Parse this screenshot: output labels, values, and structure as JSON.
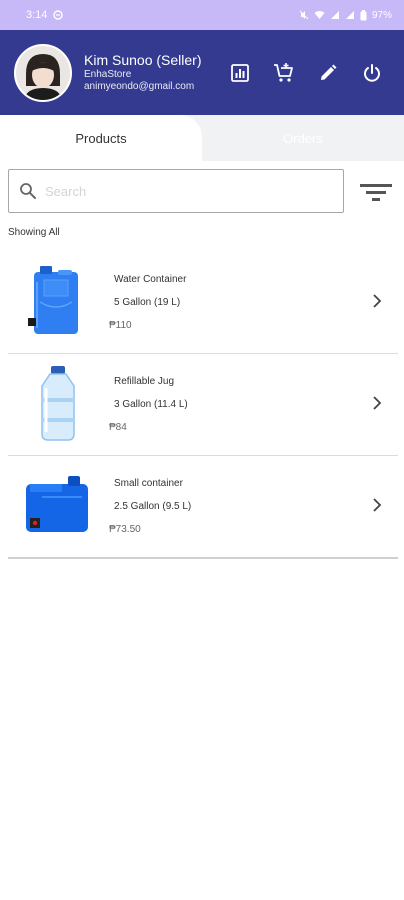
{
  "status_bar": {
    "time": "3:14",
    "battery": "97%"
  },
  "profile": {
    "name": "Kim Sunoo (Seller)",
    "store": "EnhaStore",
    "email": "animyeondo@gmail.com"
  },
  "header_actions": [
    "report-icon",
    "cart-icon",
    "edit-icon",
    "power-icon"
  ],
  "tabs": [
    {
      "label": "Products",
      "active": true
    },
    {
      "label": "Orders",
      "active": false
    }
  ],
  "search": {
    "placeholder": "Search"
  },
  "filter_label": "Showing All",
  "products": [
    {
      "name": "Water Container",
      "size": "5 Gallon (19 L)",
      "price": "₱110"
    },
    {
      "name": "Refillable Jug",
      "size": "3 Gallon (11.4 L)",
      "price": "₱84"
    },
    {
      "name": "Small container",
      "size": "2.5 Gallon (9.5 L)",
      "price": "₱73.50"
    }
  ],
  "colors": {
    "header": "#333a8f",
    "status_bar": "#c7b8f7",
    "tab_background": "#f1f2f4"
  }
}
